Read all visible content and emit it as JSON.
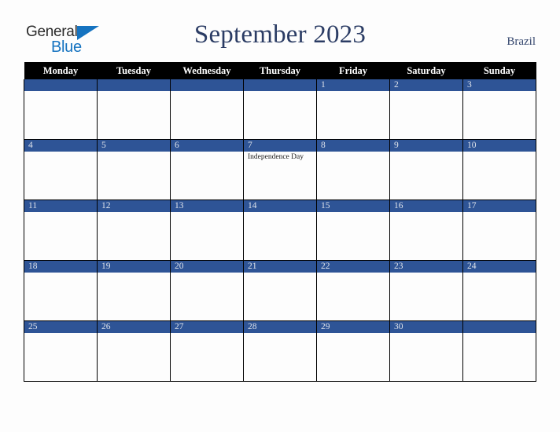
{
  "brand": {
    "name_part1": "General",
    "name_part2": "Blue",
    "triangle_icon": "triangle-icon",
    "color_dark": "#2b2b2b",
    "color_blue": "#1573c0"
  },
  "header": {
    "title": "September 2023",
    "country": "Brazil",
    "title_color": "#2b3c64"
  },
  "calendar": {
    "accent_color": "#2e5496",
    "header_bg": "#000000",
    "weekday_headers": [
      "Monday",
      "Tuesday",
      "Wednesday",
      "Thursday",
      "Friday",
      "Saturday",
      "Sunday"
    ],
    "weeks": [
      [
        {
          "day": "",
          "events": []
        },
        {
          "day": "",
          "events": []
        },
        {
          "day": "",
          "events": []
        },
        {
          "day": "",
          "events": []
        },
        {
          "day": "1",
          "events": []
        },
        {
          "day": "2",
          "events": []
        },
        {
          "day": "3",
          "events": []
        }
      ],
      [
        {
          "day": "4",
          "events": []
        },
        {
          "day": "5",
          "events": []
        },
        {
          "day": "6",
          "events": []
        },
        {
          "day": "7",
          "events": [
            "Independence Day"
          ]
        },
        {
          "day": "8",
          "events": []
        },
        {
          "day": "9",
          "events": []
        },
        {
          "day": "10",
          "events": []
        }
      ],
      [
        {
          "day": "11",
          "events": []
        },
        {
          "day": "12",
          "events": []
        },
        {
          "day": "13",
          "events": []
        },
        {
          "day": "14",
          "events": []
        },
        {
          "day": "15",
          "events": []
        },
        {
          "day": "16",
          "events": []
        },
        {
          "day": "17",
          "events": []
        }
      ],
      [
        {
          "day": "18",
          "events": []
        },
        {
          "day": "19",
          "events": []
        },
        {
          "day": "20",
          "events": []
        },
        {
          "day": "21",
          "events": []
        },
        {
          "day": "22",
          "events": []
        },
        {
          "day": "23",
          "events": []
        },
        {
          "day": "24",
          "events": []
        }
      ],
      [
        {
          "day": "25",
          "events": []
        },
        {
          "day": "26",
          "events": []
        },
        {
          "day": "27",
          "events": []
        },
        {
          "day": "28",
          "events": []
        },
        {
          "day": "29",
          "events": []
        },
        {
          "day": "30",
          "events": []
        },
        {
          "day": "",
          "events": []
        }
      ]
    ]
  }
}
